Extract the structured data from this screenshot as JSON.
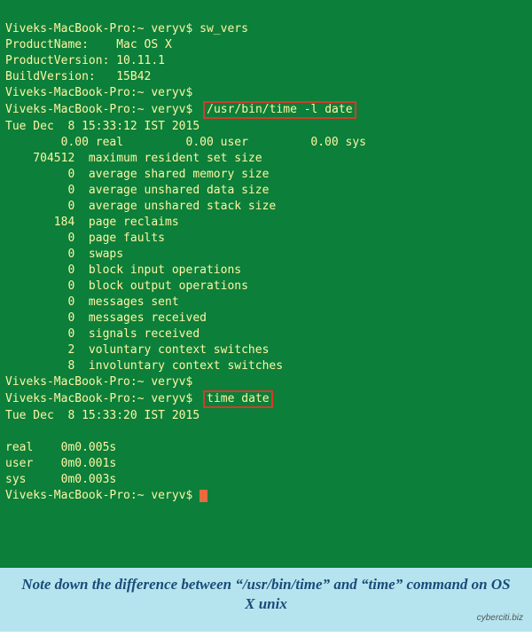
{
  "prompt": "Viveks-MacBook-Pro:~ veryv$ ",
  "cmd1": "sw_vers",
  "sw_vers_lines": [
    "ProductName:    Mac OS X",
    "ProductVersion: 10.11.1",
    "BuildVersion:   15B42"
  ],
  "cmd2_boxed": "/usr/bin/time -l date",
  "date1": "Tue Dec  8 15:33:12 IST 2015",
  "time_summary": "        0.00 real         0.00 user         0.00 sys",
  "stats": [
    "    704512  maximum resident set size",
    "         0  average shared memory size",
    "         0  average unshared data size",
    "         0  average unshared stack size",
    "       184  page reclaims",
    "         0  page faults",
    "         0  swaps",
    "         0  block input operations",
    "         0  block output operations",
    "         0  messages sent",
    "         0  messages received",
    "         0  signals received",
    "         2  voluntary context switches",
    "         8  involuntary context switches"
  ],
  "cmd3_boxed": "time date",
  "date2": "Tue Dec  8 15:33:20 IST 2015",
  "timing": [
    "real    0m0.005s",
    "user    0m0.001s",
    "sys     0m0.003s"
  ],
  "caption": "Note down the difference between “/usr/bin/time” and “time” command on OS X unix",
  "credit": "cyberciti.biz"
}
